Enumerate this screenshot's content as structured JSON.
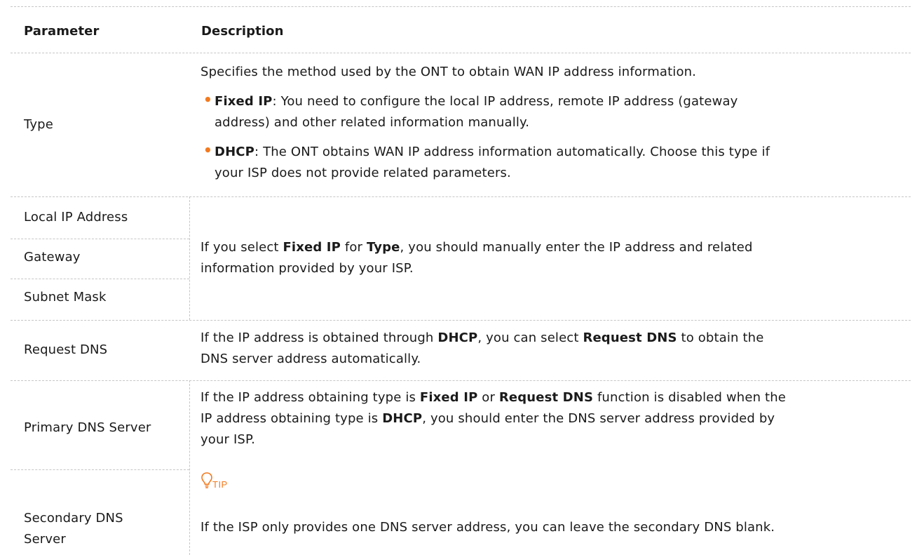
{
  "table": {
    "headers": {
      "parameter": "Parameter",
      "description": "Description"
    },
    "rows": {
      "type": {
        "parameter": "Type",
        "intro": "Specifies the method used by the ONT to obtain WAN IP address information.",
        "bullets": [
          {
            "term": "Fixed IP",
            "line1": ": You need to configure the local IP address, remote IP address (gateway",
            "line2": "address) and other related information manually."
          },
          {
            "term": "DHCP",
            "line1": ": The ONT obtains WAN IP address information automatically. Choose this type if",
            "line2": "your ISP does not provide related parameters."
          }
        ]
      },
      "fixed": {
        "parameters": [
          "Local IP Address",
          "Gateway",
          "Subnet Mask"
        ],
        "d1": "If you select ",
        "d2": "Fixed IP",
        "d3": " for ",
        "d4": "Type",
        "d5": ", you should manually enter the IP address and related",
        "d6": "information provided by your ISP."
      },
      "request_dns": {
        "parameter": "Request DNS",
        "d1": "If the IP address is obtained through ",
        "d2": "DHCP",
        "d3": ", you can select ",
        "d4": "Request DNS",
        "d5": " to obtain the",
        "d6": "DNS server address automatically."
      },
      "dns": {
        "parameter_primary": "Primary DNS Server",
        "parameter_secondary_line1": "Secondary DNS",
        "parameter_secondary_line2": "Server",
        "d1": "If the IP address obtaining type is ",
        "d2": "Fixed IP",
        "d3": " or ",
        "d4": "Request DNS",
        "d5": " function is disabled when the",
        "d6": "IP address obtaining type is ",
        "d7": "DHCP",
        "d8": ", you should enter the DNS server address provided by",
        "d9": "your ISP.",
        "tip_label": "TIP",
        "tip_icon": "lightbulb-icon",
        "tip_text": "If the ISP only provides one DNS server address, you can leave the secondary DNS blank."
      }
    }
  },
  "colors": {
    "accent": "#f37a1f",
    "border": "#c6c6c6",
    "text": "#1a1a1a"
  }
}
